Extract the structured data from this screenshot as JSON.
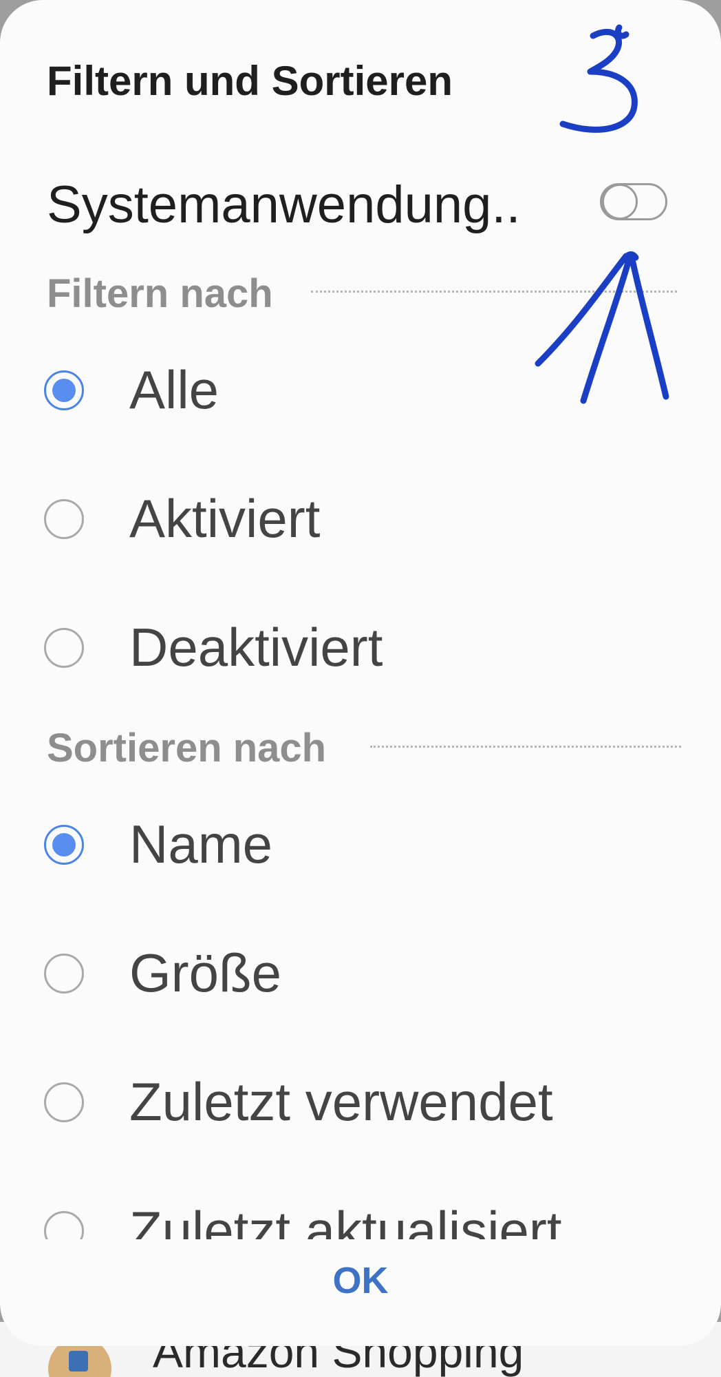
{
  "background_app": {
    "row_label": "Amazon Shopping"
  },
  "dialog": {
    "title": "Filtern und Sortieren",
    "system_toggle": {
      "label": "Systemanwendung..",
      "on": false
    },
    "filter_section": {
      "header": "Filtern nach",
      "options": [
        {
          "label": "Alle",
          "selected": true
        },
        {
          "label": "Aktiviert",
          "selected": false
        },
        {
          "label": "Deaktiviert",
          "selected": false
        }
      ]
    },
    "sort_section": {
      "header": "Sortieren nach",
      "options": [
        {
          "label": "Name",
          "selected": true
        },
        {
          "label": "Größe",
          "selected": false
        },
        {
          "label": "Zuletzt verwendet",
          "selected": false
        },
        {
          "label": "Zuletzt aktualisiert",
          "selected": false
        }
      ]
    },
    "ok_label": "OK"
  },
  "annotation": {
    "handwritten_number": "3",
    "color": "#1a3fc4"
  },
  "colors": {
    "accent": "#5a8df0",
    "ok_text": "#3d72c4",
    "section_header": "#8e8e8e"
  }
}
